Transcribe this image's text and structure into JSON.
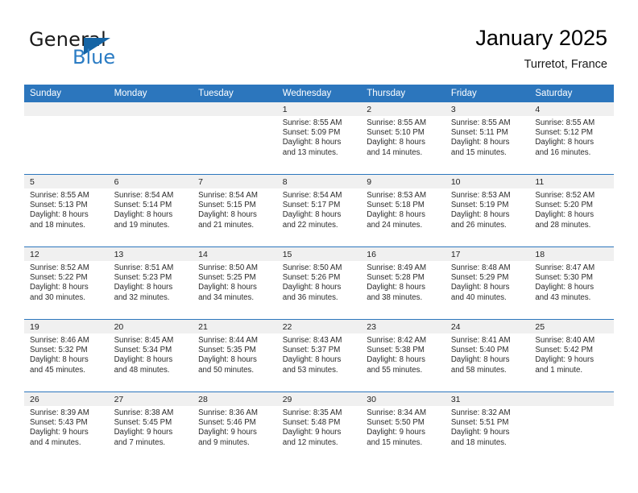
{
  "brand": {
    "name_part1": "General",
    "name_part2": "Blue",
    "logo_icon": "blue-triangle-logo"
  },
  "header": {
    "title": "January 2025",
    "location": "Turretot, France"
  },
  "colors": {
    "header_blue": "#2c76bd",
    "brand_blue": "#2b7cc4",
    "daynum_band": "#f0f0f0",
    "grid_line": "#2c76bd"
  },
  "weekday_headers": [
    "Sunday",
    "Monday",
    "Tuesday",
    "Wednesday",
    "Thursday",
    "Friday",
    "Saturday"
  ],
  "weeks": [
    [
      {
        "day": "",
        "empty": true,
        "sunrise": "",
        "sunset": "",
        "daylight1": "",
        "daylight2": ""
      },
      {
        "day": "",
        "empty": true,
        "sunrise": "",
        "sunset": "",
        "daylight1": "",
        "daylight2": ""
      },
      {
        "day": "",
        "empty": true,
        "sunrise": "",
        "sunset": "",
        "daylight1": "",
        "daylight2": ""
      },
      {
        "day": "1",
        "empty": false,
        "sunrise": "Sunrise: 8:55 AM",
        "sunset": "Sunset: 5:09 PM",
        "daylight1": "Daylight: 8 hours",
        "daylight2": "and 13 minutes."
      },
      {
        "day": "2",
        "empty": false,
        "sunrise": "Sunrise: 8:55 AM",
        "sunset": "Sunset: 5:10 PM",
        "daylight1": "Daylight: 8 hours",
        "daylight2": "and 14 minutes."
      },
      {
        "day": "3",
        "empty": false,
        "sunrise": "Sunrise: 8:55 AM",
        "sunset": "Sunset: 5:11 PM",
        "daylight1": "Daylight: 8 hours",
        "daylight2": "and 15 minutes."
      },
      {
        "day": "4",
        "empty": false,
        "sunrise": "Sunrise: 8:55 AM",
        "sunset": "Sunset: 5:12 PM",
        "daylight1": "Daylight: 8 hours",
        "daylight2": "and 16 minutes."
      }
    ],
    [
      {
        "day": "5",
        "empty": false,
        "sunrise": "Sunrise: 8:55 AM",
        "sunset": "Sunset: 5:13 PM",
        "daylight1": "Daylight: 8 hours",
        "daylight2": "and 18 minutes."
      },
      {
        "day": "6",
        "empty": false,
        "sunrise": "Sunrise: 8:54 AM",
        "sunset": "Sunset: 5:14 PM",
        "daylight1": "Daylight: 8 hours",
        "daylight2": "and 19 minutes."
      },
      {
        "day": "7",
        "empty": false,
        "sunrise": "Sunrise: 8:54 AM",
        "sunset": "Sunset: 5:15 PM",
        "daylight1": "Daylight: 8 hours",
        "daylight2": "and 21 minutes."
      },
      {
        "day": "8",
        "empty": false,
        "sunrise": "Sunrise: 8:54 AM",
        "sunset": "Sunset: 5:17 PM",
        "daylight1": "Daylight: 8 hours",
        "daylight2": "and 22 minutes."
      },
      {
        "day": "9",
        "empty": false,
        "sunrise": "Sunrise: 8:53 AM",
        "sunset": "Sunset: 5:18 PM",
        "daylight1": "Daylight: 8 hours",
        "daylight2": "and 24 minutes."
      },
      {
        "day": "10",
        "empty": false,
        "sunrise": "Sunrise: 8:53 AM",
        "sunset": "Sunset: 5:19 PM",
        "daylight1": "Daylight: 8 hours",
        "daylight2": "and 26 minutes."
      },
      {
        "day": "11",
        "empty": false,
        "sunrise": "Sunrise: 8:52 AM",
        "sunset": "Sunset: 5:20 PM",
        "daylight1": "Daylight: 8 hours",
        "daylight2": "and 28 minutes."
      }
    ],
    [
      {
        "day": "12",
        "empty": false,
        "sunrise": "Sunrise: 8:52 AM",
        "sunset": "Sunset: 5:22 PM",
        "daylight1": "Daylight: 8 hours",
        "daylight2": "and 30 minutes."
      },
      {
        "day": "13",
        "empty": false,
        "sunrise": "Sunrise: 8:51 AM",
        "sunset": "Sunset: 5:23 PM",
        "daylight1": "Daylight: 8 hours",
        "daylight2": "and 32 minutes."
      },
      {
        "day": "14",
        "empty": false,
        "sunrise": "Sunrise: 8:50 AM",
        "sunset": "Sunset: 5:25 PM",
        "daylight1": "Daylight: 8 hours",
        "daylight2": "and 34 minutes."
      },
      {
        "day": "15",
        "empty": false,
        "sunrise": "Sunrise: 8:50 AM",
        "sunset": "Sunset: 5:26 PM",
        "daylight1": "Daylight: 8 hours",
        "daylight2": "and 36 minutes."
      },
      {
        "day": "16",
        "empty": false,
        "sunrise": "Sunrise: 8:49 AM",
        "sunset": "Sunset: 5:28 PM",
        "daylight1": "Daylight: 8 hours",
        "daylight2": "and 38 minutes."
      },
      {
        "day": "17",
        "empty": false,
        "sunrise": "Sunrise: 8:48 AM",
        "sunset": "Sunset: 5:29 PM",
        "daylight1": "Daylight: 8 hours",
        "daylight2": "and 40 minutes."
      },
      {
        "day": "18",
        "empty": false,
        "sunrise": "Sunrise: 8:47 AM",
        "sunset": "Sunset: 5:30 PM",
        "daylight1": "Daylight: 8 hours",
        "daylight2": "and 43 minutes."
      }
    ],
    [
      {
        "day": "19",
        "empty": false,
        "sunrise": "Sunrise: 8:46 AM",
        "sunset": "Sunset: 5:32 PM",
        "daylight1": "Daylight: 8 hours",
        "daylight2": "and 45 minutes."
      },
      {
        "day": "20",
        "empty": false,
        "sunrise": "Sunrise: 8:45 AM",
        "sunset": "Sunset: 5:34 PM",
        "daylight1": "Daylight: 8 hours",
        "daylight2": "and 48 minutes."
      },
      {
        "day": "21",
        "empty": false,
        "sunrise": "Sunrise: 8:44 AM",
        "sunset": "Sunset: 5:35 PM",
        "daylight1": "Daylight: 8 hours",
        "daylight2": "and 50 minutes."
      },
      {
        "day": "22",
        "empty": false,
        "sunrise": "Sunrise: 8:43 AM",
        "sunset": "Sunset: 5:37 PM",
        "daylight1": "Daylight: 8 hours",
        "daylight2": "and 53 minutes."
      },
      {
        "day": "23",
        "empty": false,
        "sunrise": "Sunrise: 8:42 AM",
        "sunset": "Sunset: 5:38 PM",
        "daylight1": "Daylight: 8 hours",
        "daylight2": "and 55 minutes."
      },
      {
        "day": "24",
        "empty": false,
        "sunrise": "Sunrise: 8:41 AM",
        "sunset": "Sunset: 5:40 PM",
        "daylight1": "Daylight: 8 hours",
        "daylight2": "and 58 minutes."
      },
      {
        "day": "25",
        "empty": false,
        "sunrise": "Sunrise: 8:40 AM",
        "sunset": "Sunset: 5:42 PM",
        "daylight1": "Daylight: 9 hours",
        "daylight2": "and 1 minute."
      }
    ],
    [
      {
        "day": "26",
        "empty": false,
        "sunrise": "Sunrise: 8:39 AM",
        "sunset": "Sunset: 5:43 PM",
        "daylight1": "Daylight: 9 hours",
        "daylight2": "and 4 minutes."
      },
      {
        "day": "27",
        "empty": false,
        "sunrise": "Sunrise: 8:38 AM",
        "sunset": "Sunset: 5:45 PM",
        "daylight1": "Daylight: 9 hours",
        "daylight2": "and 7 minutes."
      },
      {
        "day": "28",
        "empty": false,
        "sunrise": "Sunrise: 8:36 AM",
        "sunset": "Sunset: 5:46 PM",
        "daylight1": "Daylight: 9 hours",
        "daylight2": "and 9 minutes."
      },
      {
        "day": "29",
        "empty": false,
        "sunrise": "Sunrise: 8:35 AM",
        "sunset": "Sunset: 5:48 PM",
        "daylight1": "Daylight: 9 hours",
        "daylight2": "and 12 minutes."
      },
      {
        "day": "30",
        "empty": false,
        "sunrise": "Sunrise: 8:34 AM",
        "sunset": "Sunset: 5:50 PM",
        "daylight1": "Daylight: 9 hours",
        "daylight2": "and 15 minutes."
      },
      {
        "day": "31",
        "empty": false,
        "sunrise": "Sunrise: 8:32 AM",
        "sunset": "Sunset: 5:51 PM",
        "daylight1": "Daylight: 9 hours",
        "daylight2": "and 18 minutes."
      },
      {
        "day": "",
        "empty": true,
        "sunrise": "",
        "sunset": "",
        "daylight1": "",
        "daylight2": ""
      }
    ]
  ]
}
